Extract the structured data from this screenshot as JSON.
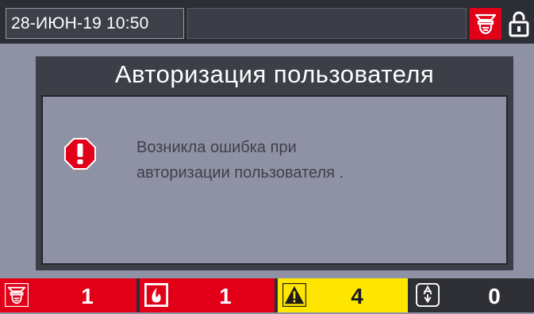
{
  "header": {
    "datetime": "28-ИЮН-19 10:50",
    "fire_alarm_icon": "fire-detector-icon",
    "lock_icon": "lock-open-icon"
  },
  "dialog": {
    "title": "Авторизация пользователя",
    "icon": "error-icon",
    "message_line1": "Возникла ошибка при",
    "message_line2": "авторизации пользователя ."
  },
  "status": {
    "fire_count": "1",
    "alarm_count": "1",
    "warning_count": "4",
    "fault_count": "0"
  },
  "colors": {
    "alarm_red": "#e10018",
    "warning_yellow": "#ffe600",
    "panel_dark": "#3c3f48",
    "background": "#8f92a5"
  }
}
